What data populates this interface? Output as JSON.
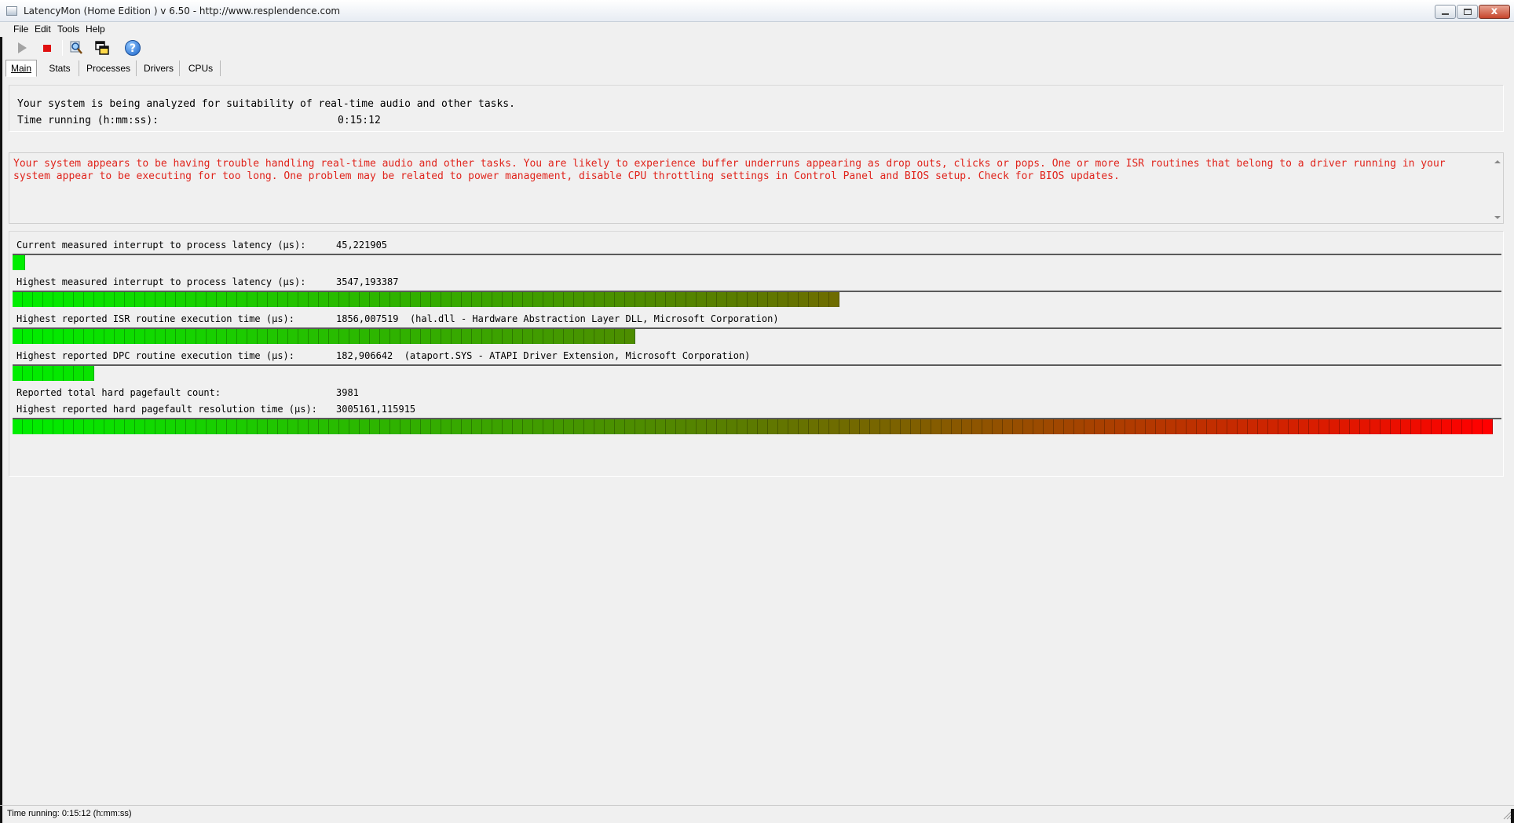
{
  "window": {
    "title": "LatencyMon  (Home Edition )  v 6.50 - http://www.resplendence.com",
    "minimize_label": "",
    "maximize_label": "",
    "close_label": "x"
  },
  "menu": {
    "items": [
      {
        "label": "File"
      },
      {
        "label": "Edit"
      },
      {
        "label": "Tools"
      },
      {
        "label": "Help"
      }
    ]
  },
  "toolbar": {
    "icons": [
      "play-icon",
      "stop-icon",
      "magnifier-icon",
      "windows-icon",
      "help-icon"
    ],
    "help_glyph": "?"
  },
  "tabs": [
    {
      "label": "Main",
      "active": true
    },
    {
      "label": "Stats",
      "active": false
    },
    {
      "label": "Processes",
      "active": false
    },
    {
      "label": "Drivers",
      "active": false
    },
    {
      "label": "CPUs",
      "active": false
    }
  ],
  "status": {
    "analyzing_text": "Your system is being analyzed for suitability of real-time audio and other tasks.",
    "time_running_label": "Time running (h:mm:ss):",
    "time_running_value": "0:15:12"
  },
  "message": {
    "text": "Your system appears to be having trouble handling real-time audio and other tasks. You are likely to experience buffer underruns appearing as drop outs, clicks or pops. One or more ISR routines that belong to a driver running in your system appear to be executing for too long. One problem may be related to power management, disable CPU throttling settings in Control Panel and BIOS setup. Check for BIOS updates.",
    "color": "#e0241c"
  },
  "metrics": {
    "current_latency": {
      "label": "Current measured interrupt to process latency (µs):",
      "value": "45,221905",
      "bar_fraction": 0.008
    },
    "highest_latency": {
      "label": "Highest measured interrupt to process latency (µs):",
      "value": "3547,193387",
      "bar_fraction": 0.556
    },
    "isr_time": {
      "label": "Highest reported ISR routine execution time (µs):",
      "value": "1856,007519",
      "detail": "(hal.dll - Hardware Abstraction Layer DLL, Microsoft Corporation)",
      "bar_fraction": 0.42
    },
    "dpc_time": {
      "label": "Highest reported DPC routine execution time (µs):",
      "value": "182,906642",
      "detail": "(ataport.SYS - ATAPI Driver Extension, Microsoft Corporation)",
      "bar_fraction": 0.053
    },
    "pagefault_count": {
      "label": "Reported total hard pagefault count:",
      "value": "3981"
    },
    "pagefault_time": {
      "label": "Highest reported hard pagefault resolution time (µs):",
      "value": "3005161,115915",
      "bar_fraction": 1.0
    }
  },
  "statusbar": {
    "text": "Time running: 0:15:12  (h:mm:ss)"
  },
  "colors": {
    "bar_start": "#00ee00",
    "bar_mid": "#5c7a00",
    "bar_end": "#ff0000",
    "background": "#f0f0f0"
  }
}
